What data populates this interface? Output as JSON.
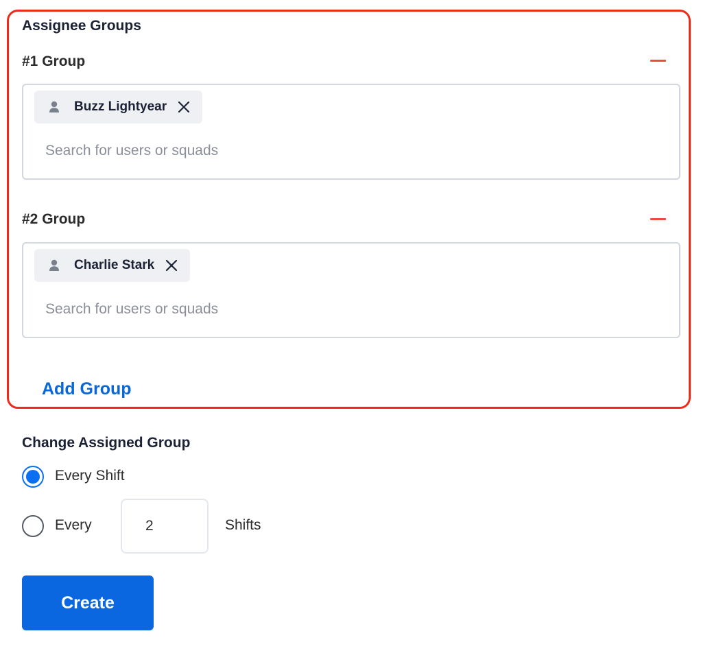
{
  "assignee_groups": {
    "title": "Assignee Groups",
    "groups": [
      {
        "title": "#1 Group",
        "members": [
          {
            "name": "Buzz Lightyear",
            "icon": "user-icon"
          }
        ],
        "search_placeholder": "Search for users or squads"
      },
      {
        "title": "#2 Group",
        "members": [
          {
            "name": "Charlie Stark",
            "icon": "user-icon"
          }
        ],
        "search_placeholder": "Search for users or squads"
      }
    ],
    "add_group_label": "Add Group"
  },
  "change_assigned_group": {
    "title": "Change Assigned Group",
    "options": [
      {
        "label": "Every Shift",
        "selected": true
      },
      {
        "label_prefix": "Every",
        "value": "2",
        "label_suffix": "Shifts",
        "selected": false
      }
    ]
  },
  "actions": {
    "create_label": "Create"
  },
  "colors": {
    "highlight_border": "#ec2c1a",
    "remove_icon": "#ec4b3c",
    "link": "#0a67d8",
    "primary_button": "#0a67e0",
    "radio_selected": "#0b6ff2"
  }
}
